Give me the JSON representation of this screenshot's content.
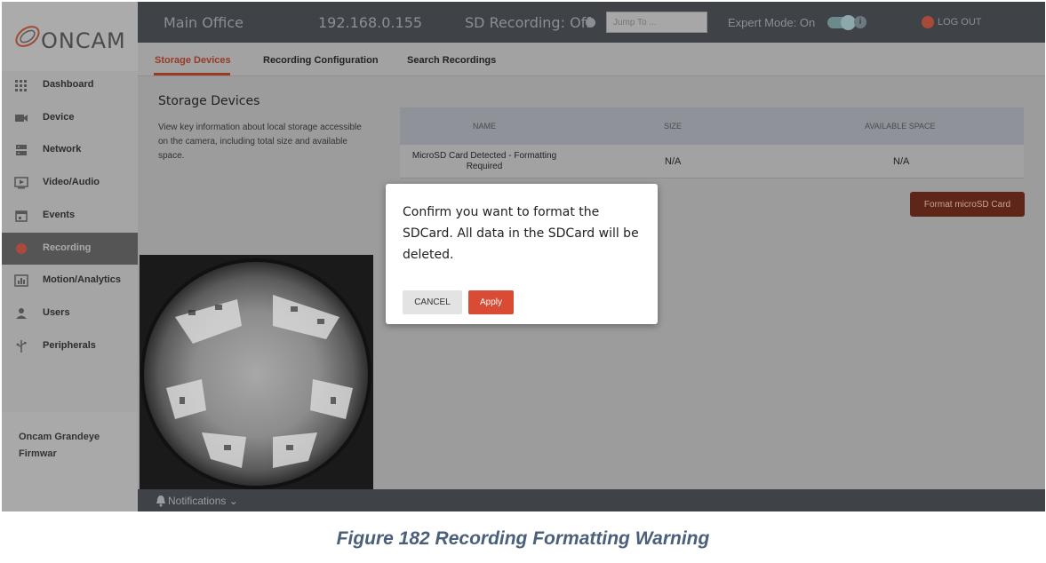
{
  "brand": {
    "name": "ONCAM"
  },
  "header": {
    "location": "Main Office",
    "ip": "192.168.0.155",
    "sd_recording": "SD Recording: Off",
    "jump_placeholder": "Jump To ...",
    "expert_mode": "Expert Mode: On",
    "expert_mode_on": true,
    "logout": "LOG OUT"
  },
  "sidebar": {
    "items": [
      {
        "label": "Dashboard",
        "icon": "grid-icon"
      },
      {
        "label": "Device",
        "icon": "camera-icon"
      },
      {
        "label": "Network",
        "icon": "server-icon"
      },
      {
        "label": "Video/Audio",
        "icon": "play-icon"
      },
      {
        "label": "Events",
        "icon": "calendar-icon"
      },
      {
        "label": "Recording",
        "icon": "record-dot-icon",
        "active": true
      },
      {
        "label": "Motion/Analytics",
        "icon": "bar-chart-icon"
      },
      {
        "label": "Users",
        "icon": "user-icon"
      },
      {
        "label": "Peripherals",
        "icon": "usb-icon"
      }
    ],
    "footer": {
      "line1": "Oncam Grandeye",
      "line2": "Firmwar"
    }
  },
  "tabs": [
    {
      "label": "Storage Devices",
      "active": true
    },
    {
      "label": "Recording Configuration"
    },
    {
      "label": "Search Recordings"
    }
  ],
  "content": {
    "title": "Storage Devices",
    "description": "View key information about local storage accessible on the camera, including total size and available space.",
    "table": {
      "columns": [
        "NAME",
        "SIZE",
        "AVAILABLE SPACE"
      ],
      "rows": [
        {
          "name": "MicroSD Card Detected - Formatting Required",
          "size": "N/A",
          "available": "N/A"
        }
      ]
    },
    "format_button": "Format microSD Card"
  },
  "dialog": {
    "message": "Confirm you want to format the SDCard. All data in the SDCard will be deleted.",
    "cancel": "CANCEL",
    "apply": "Apply"
  },
  "bottom_bar": {
    "notifications": "Notifications"
  },
  "caption": "Figure 182 Recording Formatting Warning",
  "colors": {
    "accent": "#9a3a26",
    "apply_button": "#d94b34",
    "header_bg": "#3f4347",
    "caption": "#4a5f7a"
  }
}
